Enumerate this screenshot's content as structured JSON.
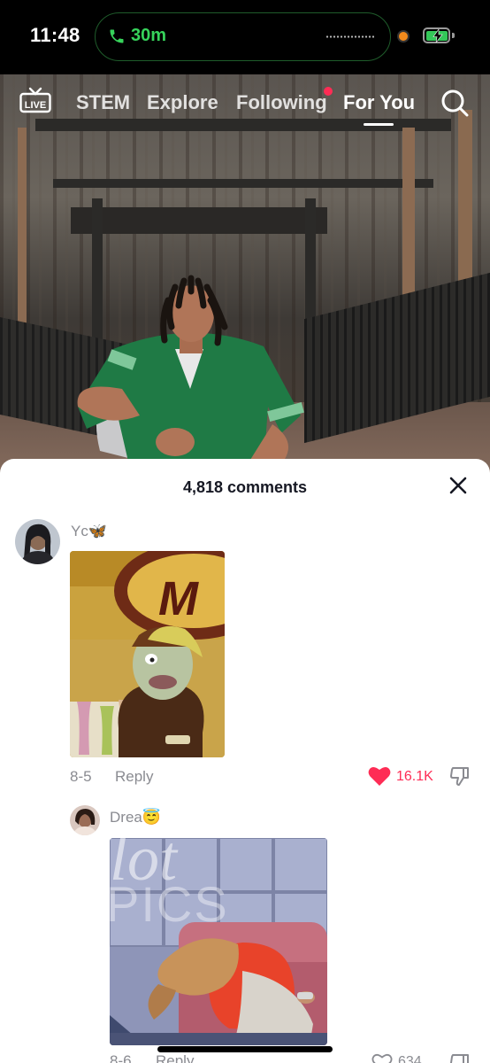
{
  "status": {
    "time": "11:48",
    "call_duration": "30m"
  },
  "nav": {
    "tabs": [
      "STEM",
      "Explore",
      "Following",
      "For You"
    ],
    "active_tab": "For You",
    "live_label": "LIVE"
  },
  "comments_sheet": {
    "title": "4,818 comments",
    "comments": [
      {
        "username": "Yc",
        "username_emoji": "🦋",
        "date": "8-5",
        "reply_label": "Reply",
        "likes": "16.1K",
        "liked": true
      },
      {
        "username": "Drea",
        "username_emoji": "😇",
        "date": "8-6",
        "reply_label": "Reply",
        "likes": "634",
        "liked": false
      }
    ],
    "gif2_caption_line1": "lot",
    "gif2_caption_line2": "PICS"
  },
  "colors": {
    "accent": "#fe2c55",
    "call_green": "#37d35b",
    "battery_green": "#34c759",
    "muted_text": "#8a8b91"
  }
}
